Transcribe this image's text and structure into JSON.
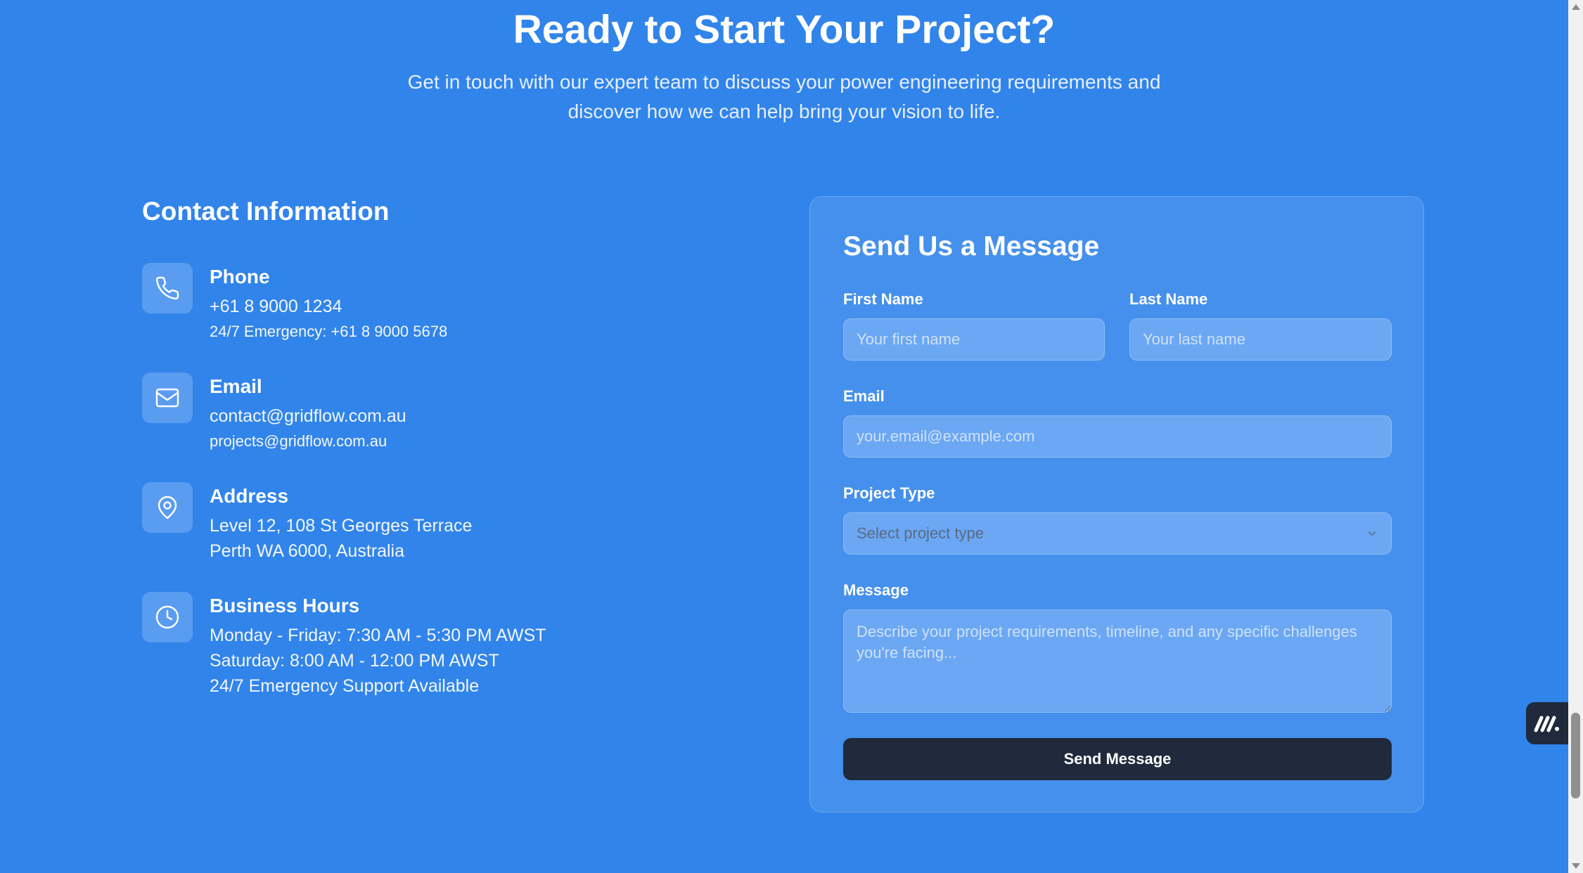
{
  "hero": {
    "title": "Ready to Start Your Project?",
    "subtitle": "Get in touch with our expert team to discuss your power engineering requirements and discover how we can help bring your vision to life."
  },
  "contact": {
    "title": "Contact Information",
    "phone": {
      "label": "Phone",
      "primary": "+61 8 9000 1234",
      "secondary": "24/7 Emergency: +61 8 9000 5678",
      "icon": "phone-icon"
    },
    "email": {
      "label": "Email",
      "primary": "contact@gridflow.com.au",
      "secondary": "projects@gridflow.com.au",
      "icon": "mail-icon"
    },
    "address": {
      "label": "Address",
      "line1": "Level 12, 108 St Georges Terrace",
      "line2": "Perth WA 6000, Australia",
      "icon": "map-pin-icon"
    },
    "hours": {
      "label": "Business Hours",
      "line1": "Monday - Friday: 7:30 AM - 5:30 PM AWST",
      "line2": "Saturday: 8:00 AM - 12:00 PM AWST",
      "line3": "24/7 Emergency Support Available",
      "icon": "clock-icon"
    }
  },
  "form": {
    "title": "Send Us a Message",
    "first_name": {
      "label": "First Name",
      "placeholder": "Your first name",
      "value": ""
    },
    "last_name": {
      "label": "Last Name",
      "placeholder": "Your last name",
      "value": ""
    },
    "email": {
      "label": "Email",
      "placeholder": "your.email@example.com",
      "value": ""
    },
    "project_type": {
      "label": "Project Type",
      "selected": "Select project type"
    },
    "message": {
      "label": "Message",
      "placeholder": "Describe your project requirements, timeline, and any specific challenges you're facing...",
      "value": ""
    },
    "submit_label": "Send Message"
  },
  "colors": {
    "background": "#3184ea",
    "card": "#4590ec",
    "input": "#6ba7f3",
    "button": "#1f2a3c"
  }
}
